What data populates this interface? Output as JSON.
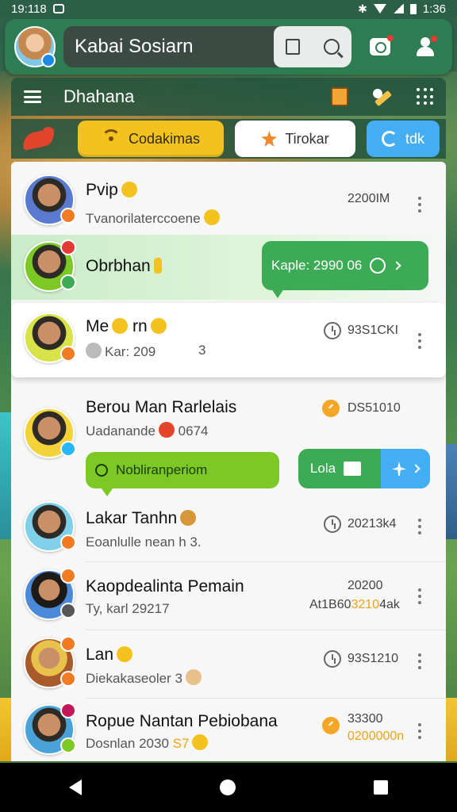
{
  "status": {
    "time": "19:118",
    "battery": "1:36"
  },
  "header": {
    "title": "Kabai Sosiarn"
  },
  "toolbar": {
    "title": "Dhahana"
  },
  "tabs": [
    {
      "label": "Codakimas"
    },
    {
      "label": "Tirokar"
    },
    {
      "label": "tdk"
    }
  ],
  "chats": [
    {
      "name": "Pvip",
      "message": "Tvanorilaterccoene",
      "time": "2200IM"
    },
    {
      "name": "Obrbhan",
      "message": "",
      "time": ""
    },
    {
      "name": "Me",
      "name_suffix": "rn",
      "message": "Kar: 209",
      "message_extra": "3",
      "time": "93S1CKI"
    },
    {
      "name": "Berou Man Rarlelais",
      "message": "Uadanande",
      "message_extra": "0674",
      "time": "DS51010"
    },
    {
      "name": "Lakar Tanhn",
      "message": "Eoanlulle nean h 3.",
      "time": "20213k4"
    },
    {
      "name": "Kaopdealinta Pemain",
      "message": "Ty, karl 29217",
      "time": "20200",
      "time_line2_a": "At1B60",
      "time_line2_b": "3210",
      "time_line2_c": "4ak"
    },
    {
      "name": "Lan",
      "message": "Diekakaseoler",
      "message_extra": "3",
      "time": "93S1210"
    },
    {
      "name": "Ropue Nantan Pebiobana",
      "message": "Dosnlan 2030",
      "message_extra": "S7",
      "time": "33300",
      "time_line2": "0200000n"
    }
  ],
  "bubbles": {
    "reply": "Kaple: 2990 06",
    "search": "Nobliranperiom",
    "split_left": "Lola"
  },
  "colors": {
    "header_green": "#2e7d52",
    "tab_yellow": "#f4c21f",
    "tab_blue": "#45aef2",
    "bubble_green": "#3daa55",
    "lime": "#7cc824",
    "accent_orange": "#f0a21a"
  }
}
